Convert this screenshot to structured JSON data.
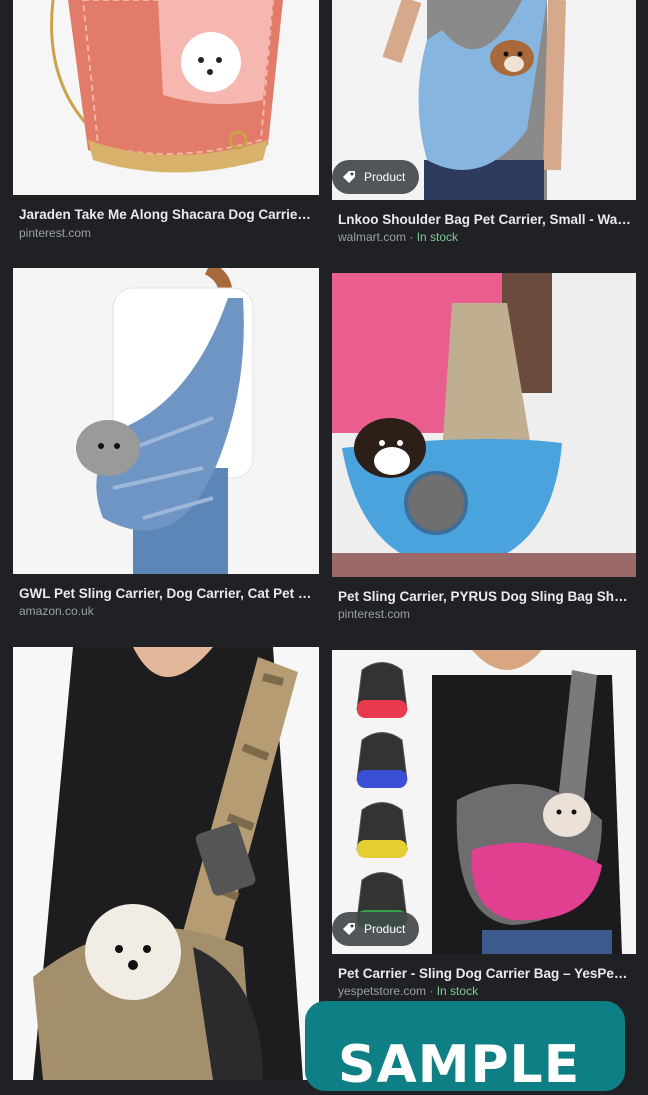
{
  "results": [
    {
      "title": "Jaraden Take Me Along Shacara Dog Carrie…",
      "source": "pinterest.com",
      "stock": "",
      "badge": ""
    },
    {
      "title": "Lnkoo Shoulder Bag Pet Carrier, Small - Wal…",
      "source": "walmart.com",
      "stock": "In stock",
      "badge": "Product"
    },
    {
      "title": "GWL Pet Sling Carrier, Dog Carrier, Cat Pet …",
      "source": "amazon.co.uk",
      "stock": "",
      "badge": ""
    },
    {
      "title": "Pet Sling Carrier, PYRUS Dog Sling Bag Sho…",
      "source": "pinterest.com",
      "stock": "",
      "badge": ""
    },
    {
      "title": "",
      "source": "",
      "stock": "",
      "badge": ""
    },
    {
      "title": "Pet Carrier - Sling Dog Carrier Bag – YesPe…",
      "source": "yespetstore.com",
      "stock": "In stock",
      "badge": "Product"
    }
  ],
  "separator": " · ",
  "watermark": "SAMPLE",
  "colors": {
    "background": "#202124",
    "title": "#e8eaed",
    "source": "#9aa0a6",
    "in_stock": "#81c995",
    "watermark_bg": "#0f7f86"
  }
}
